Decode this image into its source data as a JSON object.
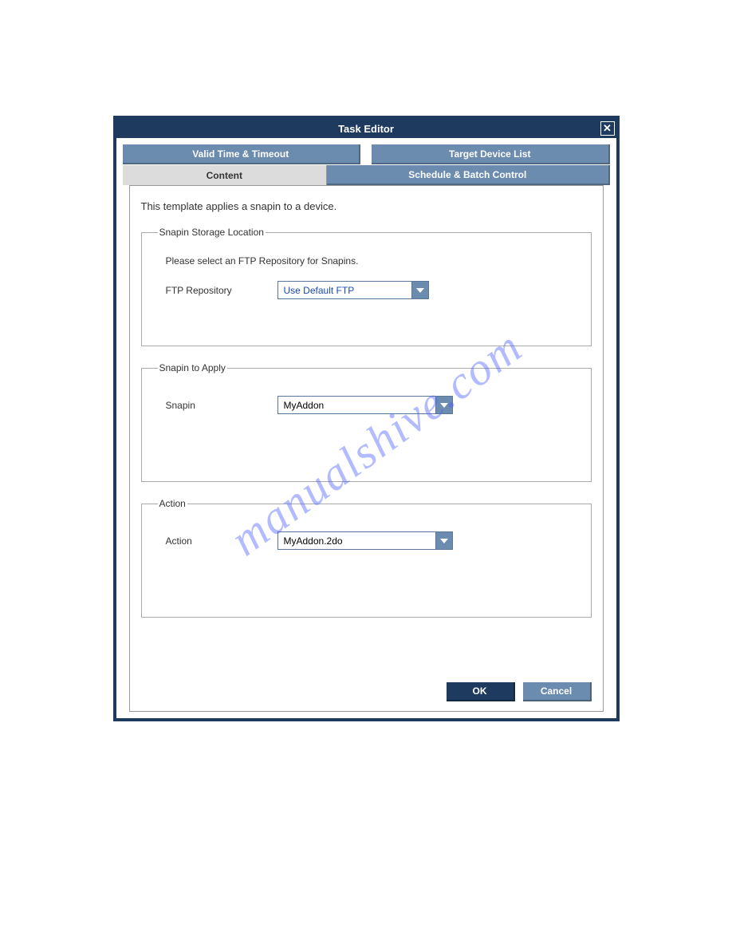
{
  "dialog": {
    "title": "Task Editor"
  },
  "tabs": {
    "upperLeft": "Valid Time & Timeout",
    "upperRight": "Target Device List",
    "lowerActive": "Content",
    "lowerInactive": "Schedule & Batch Control"
  },
  "content": {
    "intro": "This template applies a snapin to a device.",
    "storage": {
      "legend": "Snapin Storage Location",
      "hint": "Please select an FTP Repository for Snapins.",
      "label": "FTP Repository",
      "value": "Use Default FTP"
    },
    "snapin": {
      "legend": "Snapin to Apply",
      "label": "Snapin",
      "value": "MyAddon"
    },
    "action": {
      "legend": "Action",
      "label": "Action",
      "value": "MyAddon.2do"
    }
  },
  "buttons": {
    "ok": "OK",
    "cancel": "Cancel"
  },
  "watermark": "manualshive.com"
}
